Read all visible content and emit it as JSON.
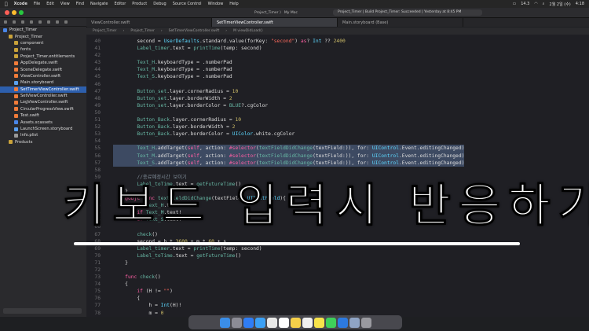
{
  "menubar": {
    "app": "Xcode",
    "items": [
      "File",
      "Edit",
      "View",
      "Find",
      "Navigate",
      "Editor",
      "Product",
      "Debug",
      "Source Control",
      "Window",
      "Help"
    ],
    "clock": "4:18",
    "date": "2월 2일 (수)",
    "battery": "14.3"
  },
  "toolbar": {
    "scheme": "Project_Timer  〉  My Mac",
    "status": "Project_Timer | Build Project_Timer: Succeeded | Yesterday at 8:45 PM"
  },
  "tabs": [
    "ViewController.swift",
    "SetTimerViewController.swift",
    "Main.storyboard (Base)"
  ],
  "jumpbar": [
    "Project_Timer",
    "Project_Timer",
    "SetTimerViewController.swift",
    "M viewDidLoad()"
  ],
  "navigator": {
    "items": [
      {
        "label": "Project_Timer",
        "indent": 0,
        "color": "#4a86e8"
      },
      {
        "label": "Project_Timer",
        "indent": 1,
        "color": "#c9a23a"
      },
      {
        "label": "component",
        "indent": 2,
        "color": "#c9a23a"
      },
      {
        "label": "fonts",
        "indent": 2,
        "color": "#c9a23a"
      },
      {
        "label": "Project_Timer.entitlements",
        "indent": 2,
        "color": "#c9a23a"
      },
      {
        "label": "AppDelegate.swift",
        "indent": 2,
        "color": "#f07c3a"
      },
      {
        "label": "SceneDelegate.swift",
        "indent": 2,
        "color": "#f07c3a"
      },
      {
        "label": "ViewController.swift",
        "indent": 2,
        "color": "#f07c3a"
      },
      {
        "label": "Main.storyboard",
        "indent": 2,
        "color": "#5aa0f0"
      },
      {
        "label": "SetTimerViewController.swift",
        "indent": 2,
        "color": "#f07c3a",
        "selected": true
      },
      {
        "label": "SetViewController.swift",
        "indent": 2,
        "color": "#f07c3a"
      },
      {
        "label": "LogViewController.swift",
        "indent": 2,
        "color": "#f07c3a"
      },
      {
        "label": "CircularProgressView.swift",
        "indent": 2,
        "color": "#f07c3a"
      },
      {
        "label": "Test.swift",
        "indent": 2,
        "color": "#f07c3a"
      },
      {
        "label": "Assets.xcassets",
        "indent": 2,
        "color": "#4a86e8"
      },
      {
        "label": "LaunchScreen.storyboard",
        "indent": 2,
        "color": "#5aa0f0"
      },
      {
        "label": "Info.plist",
        "indent": 2,
        "color": "#999999"
      },
      {
        "label": "Products",
        "indent": 1,
        "color": "#c9a23a"
      }
    ]
  },
  "code": {
    "lines": [
      {
        "n": "40",
        "t": "        second = UserDefaults.standard.value(forKey: \"second\") as? Int ?? 2400"
      },
      {
        "n": "41",
        "t": "        Label_timer.text = printTime(temp: second)"
      },
      {
        "n": "42",
        "t": ""
      },
      {
        "n": "43",
        "t": "        Text_H.keyboardType = .numberPad"
      },
      {
        "n": "44",
        "t": "        Text_M.keyboardType = .numberPad"
      },
      {
        "n": "45",
        "t": "        Text_S.keyboardType = .numberPad"
      },
      {
        "n": "46",
        "t": ""
      },
      {
        "n": "47",
        "t": "        Button_set.layer.cornerRadius = 10"
      },
      {
        "n": "48",
        "t": "        Button_set.layer.borderWidth = 2"
      },
      {
        "n": "49",
        "t": "        Button_set.layer.borderColor = BLUE?.cgColor"
      },
      {
        "n": "50",
        "t": ""
      },
      {
        "n": "51",
        "t": "        Button_Back.layer.cornerRadius = 10"
      },
      {
        "n": "52",
        "t": "        Button_Back.layer.borderWidth = 2"
      },
      {
        "n": "53",
        "t": "        Button_Back.layer.borderColor = UIColor.white.cgColor"
      },
      {
        "n": "54",
        "t": ""
      },
      {
        "n": "55",
        "t": "        Text_H.addTarget(self, action: #selector(textFieldDidChange(textField:)), for: UIControl.Event.editingChanged)",
        "hl": true
      },
      {
        "n": "56",
        "t": "        Text_M.addTarget(self, action: #selector(textFieldDidChange(textField:)), for: UIControl.Event.editingChanged)",
        "hl": true
      },
      {
        "n": "57",
        "t": "        Text_S.addTarget(self, action: #selector(textFieldDidChange(textField:)), for: UIControl.Event.editingChanged)",
        "hl": true
      },
      {
        "n": "58",
        "t": ""
      },
      {
        "n": "59",
        "t": "        //종료예정시간 보이기"
      },
      {
        "n": "60",
        "t": "        Label_toTime.text = getFutureTime()"
      },
      {
        "n": "61",
        "t": "    }"
      },
      {
        "n": "62",
        "t": "    @objc func textFieldDidChange(textField: UITextField){"
      },
      {
        "n": "63",
        "t": "        if Text_H.text!"
      },
      {
        "n": "64",
        "t": "        if Text_M.text!"
      },
      {
        "n": "65",
        "t": "        if Text_S.text!"
      },
      {
        "n": "66",
        "t": ""
      },
      {
        "n": "67",
        "t": "        check()"
      },
      {
        "n": "68",
        "t": "        second = h * 3600 + m * 60 + s"
      },
      {
        "n": "69",
        "t": "        Label_timer.text = printTime(temp: second)"
      },
      {
        "n": "70",
        "t": "        Label_toTime.text = getFutureTime()"
      },
      {
        "n": "71",
        "t": "    }"
      },
      {
        "n": "72",
        "t": ""
      },
      {
        "n": "73",
        "t": "    func check()"
      },
      {
        "n": "74",
        "t": "    {"
      },
      {
        "n": "75",
        "t": "        if (H != \"\")"
      },
      {
        "n": "76",
        "t": "        {"
      },
      {
        "n": "77",
        "t": "            h = Int(H)!"
      },
      {
        "n": "78",
        "t": "            m = 0"
      }
    ]
  },
  "overlay": {
    "text": "키보드 입력시 반응하기"
  },
  "dock": {
    "apps": [
      {
        "icon": "finder-icon",
        "color": "#3b8ee8"
      },
      {
        "icon": "launchpad-icon",
        "color": "#8c8c96"
      },
      {
        "icon": "appstore-icon",
        "color": "#2f7df5"
      },
      {
        "icon": "safari-icon",
        "color": "#3ba0f5"
      },
      {
        "icon": "chrome-icon",
        "color": "#e8e8e8"
      },
      {
        "icon": "calendar-icon",
        "color": "#ffffff"
      },
      {
        "icon": "notes-icon",
        "color": "#f5d04a"
      },
      {
        "icon": "reminders-icon",
        "color": "#f0f0f0"
      },
      {
        "icon": "kakaotalk-icon",
        "color": "#f7e34b"
      },
      {
        "icon": "messages-icon",
        "color": "#3fcf5a"
      },
      {
        "icon": "xcode-icon",
        "color": "#2d7ae0"
      },
      {
        "icon": "preview-icon",
        "color": "#8fa4c4"
      },
      {
        "icon": "trash-icon",
        "color": "#9a9aa0"
      }
    ]
  }
}
